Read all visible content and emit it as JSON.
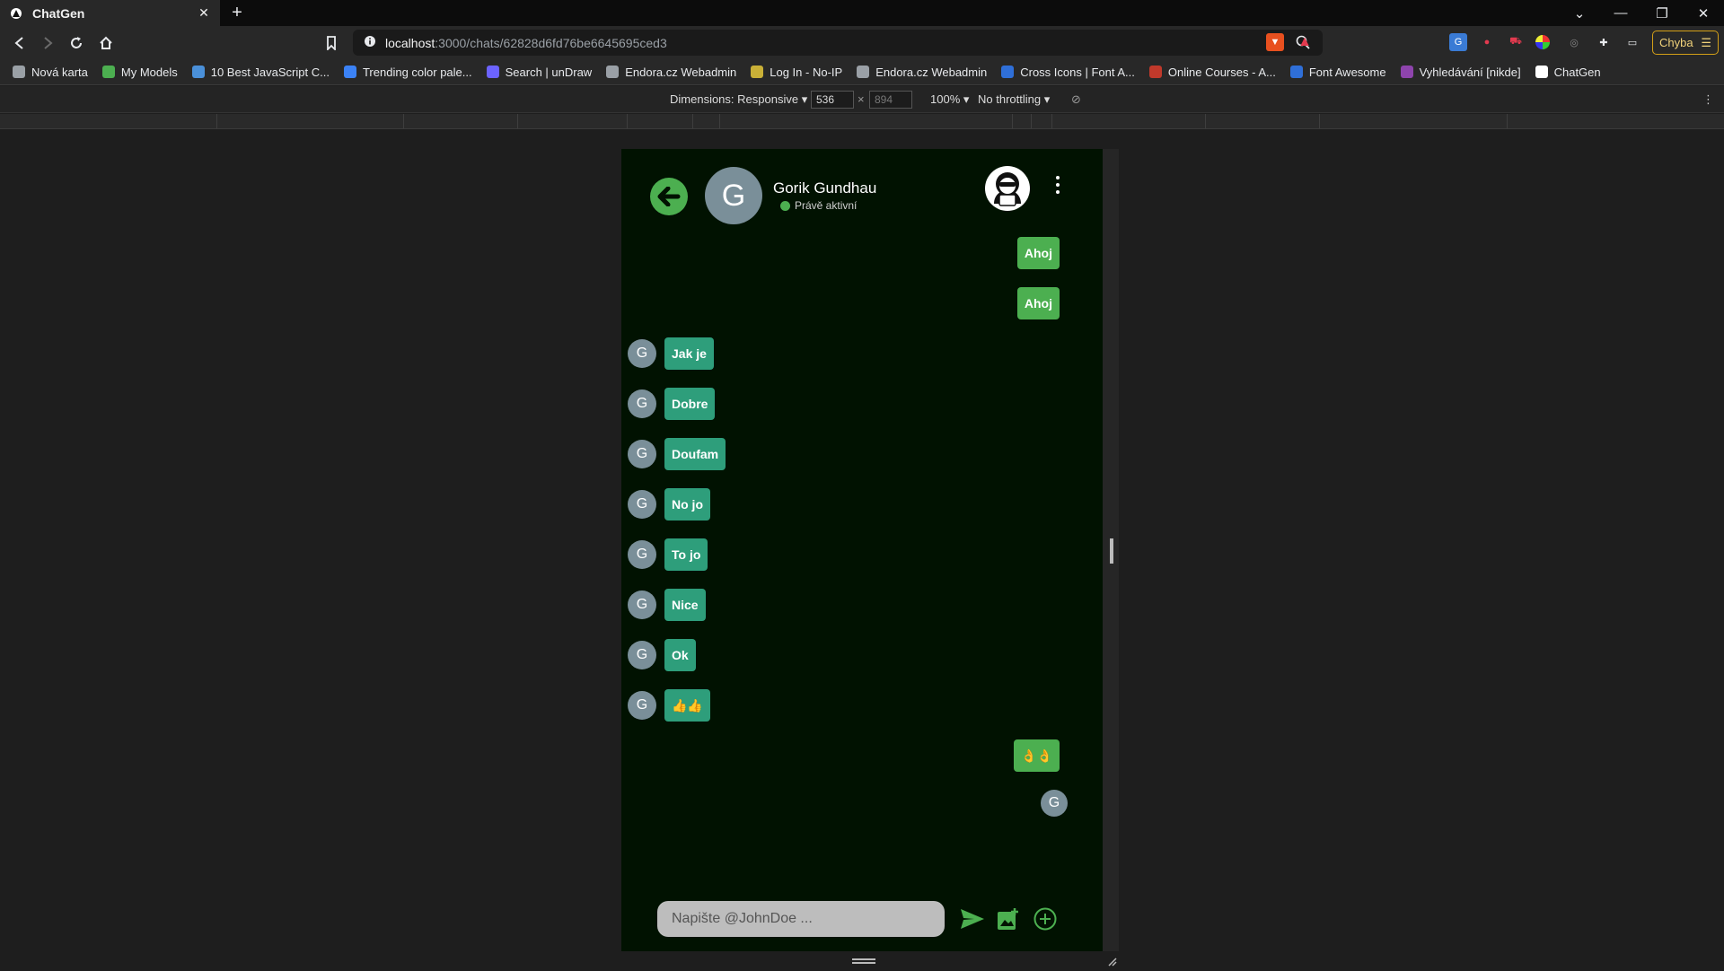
{
  "browser": {
    "tab_title": "ChatGen",
    "url_host": "localhost",
    "url_path": ":3000/chats/62828d6fd76be6645695ced3",
    "profile_button": "Chyba"
  },
  "bookmarks": [
    {
      "label": "Nová karta",
      "color": "#9aa0a6"
    },
    {
      "label": "My Models",
      "color": "#4caf50"
    },
    {
      "label": "10 Best JavaScript C...",
      "color": "#4a90d9"
    },
    {
      "label": "Trending color pale...",
      "color": "#3b82f6"
    },
    {
      "label": "Search | unDraw",
      "color": "#6c63ff"
    },
    {
      "label": "Endora.cz Webadmin",
      "color": "#9aa0a6"
    },
    {
      "label": "Log In - No-IP",
      "color": "#c9b037"
    },
    {
      "label": "Endora.cz Webadmin",
      "color": "#9aa0a6"
    },
    {
      "label": "Cross Icons | Font A...",
      "color": "#2f6fd8"
    },
    {
      "label": "Online Courses - A...",
      "color": "#c0392b"
    },
    {
      "label": "Font Awesome",
      "color": "#2f6fd8"
    },
    {
      "label": "Vyhledávání [nikde]",
      "color": "#8e44ad"
    },
    {
      "label": "ChatGen",
      "color": "#ffffff"
    }
  ],
  "devtools": {
    "dimensions_label": "Dimensions: Responsive",
    "width": "536",
    "height": "894",
    "zoom": "100%",
    "throttling": "No throttling"
  },
  "chat": {
    "contact_name": "Gorik Gundhau",
    "contact_initial": "G",
    "status_text": "Právě aktivní",
    "input_placeholder": "Napište @JohnDoe ...",
    "messages": [
      {
        "dir": "out",
        "text": "Ahoj"
      },
      {
        "dir": "out",
        "text": "Ahoj"
      },
      {
        "dir": "in",
        "text": "Jak je",
        "avatar": "G"
      },
      {
        "dir": "in",
        "text": "Dobre",
        "avatar": "G"
      },
      {
        "dir": "in",
        "text": "Doufam",
        "avatar": "G"
      },
      {
        "dir": "in",
        "text": "No jo",
        "avatar": "G"
      },
      {
        "dir": "in",
        "text": "To jo",
        "avatar": "G"
      },
      {
        "dir": "in",
        "text": "Nice",
        "avatar": "G"
      },
      {
        "dir": "in",
        "text": "Ok",
        "avatar": "G"
      },
      {
        "dir": "in",
        "text": "👍👍",
        "avatar": "G"
      },
      {
        "dir": "out",
        "text": "👌👌"
      }
    ],
    "seen_avatar": "G"
  },
  "colors": {
    "accent_green": "#4caf50",
    "incoming_bubble": "#2e9e7b",
    "chat_background": "#011201",
    "avatar_gray": "#7a8f99"
  }
}
